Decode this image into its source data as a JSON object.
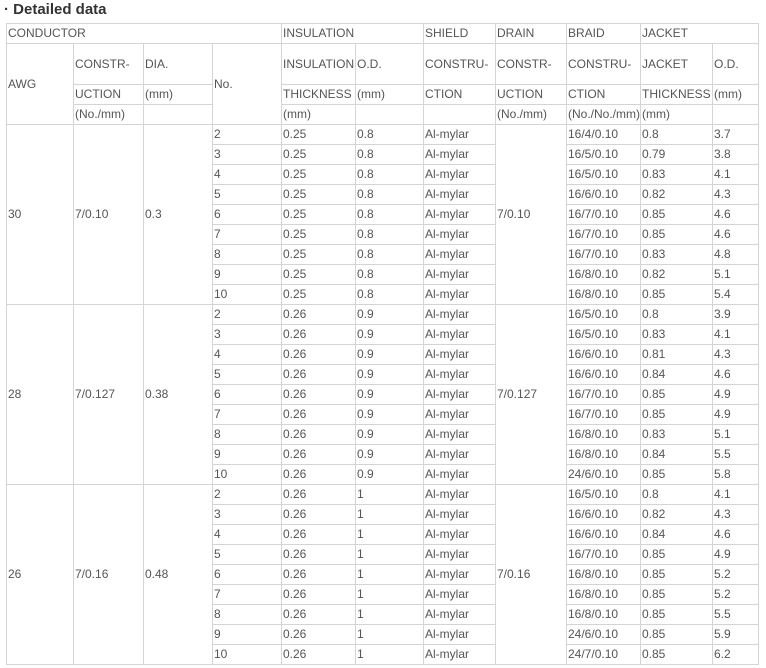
{
  "title": "· Detailed data",
  "header": {
    "conductor": "CONDUCTOR",
    "insulation": "INSULATION",
    "shield": "SHIELD",
    "drain": "DRAIN",
    "braid": "BRAID",
    "jacket": "JACKET",
    "awg": "AWG",
    "no": "No.",
    "constr": [
      "CONSTR-",
      "UCTION",
      "(No./mm)"
    ],
    "dia": [
      "DIA.",
      "(mm)"
    ],
    "ins_thick": [
      "INSULATION",
      "THICKNESS",
      "(mm)"
    ],
    "ins_od": [
      "O.D.",
      "(mm)"
    ],
    "shield_c": [
      "CONSTRU-",
      "CTION"
    ],
    "drain_c": [
      "CONSTR-",
      "UCTION",
      "(No./mm)"
    ],
    "braid_c": [
      "CONSTRU-",
      "CTION",
      "(No./No./mm)"
    ],
    "jacket_thick": [
      "JACKET",
      "THICKNESS",
      "(mm)"
    ],
    "jacket_od": [
      "O.D.",
      "(mm)"
    ]
  },
  "groups": [
    {
      "awg": "30",
      "construction": "7/0.10",
      "dia": "0.3",
      "drain": "7/0.10",
      "rows": [
        [
          "2",
          "0.25",
          "0.8",
          "Al-mylar",
          "16/4/0.10",
          "0.8",
          "3.7"
        ],
        [
          "3",
          "0.25",
          "0.8",
          "Al-mylar",
          "16/5/0.10",
          "0.79",
          "3.8"
        ],
        [
          "4",
          "0.25",
          "0.8",
          "Al-mylar",
          "16/5/0.10",
          "0.83",
          "4.1"
        ],
        [
          "5",
          "0.25",
          "0.8",
          "Al-mylar",
          "16/6/0.10",
          "0.82",
          "4.3"
        ],
        [
          "6",
          "0.25",
          "0.8",
          "Al-mylar",
          "16/7/0.10",
          "0.85",
          "4.6"
        ],
        [
          "7",
          "0.25",
          "0.8",
          "Al-mylar",
          "16/7/0.10",
          "0.85",
          "4.6"
        ],
        [
          "8",
          "0.25",
          "0.8",
          "Al-mylar",
          "16/7/0.10",
          "0.83",
          "4.8"
        ],
        [
          "9",
          "0.25",
          "0.8",
          "Al-mylar",
          "16/8/0.10",
          "0.82",
          "5.1"
        ],
        [
          "10",
          "0.25",
          "0.8",
          "Al-mylar",
          "16/8/0.10",
          "0.85",
          "5.4"
        ]
      ]
    },
    {
      "awg": "28",
      "construction": "7/0.127",
      "dia": "0.38",
      "drain": "7/0.127",
      "rows": [
        [
          "2",
          "0.26",
          "0.9",
          "Al-mylar",
          "16/5/0.10",
          "0.8",
          "3.9"
        ],
        [
          "3",
          "0.26",
          "0.9",
          "Al-mylar",
          "16/5/0.10",
          "0.83",
          "4.1"
        ],
        [
          "4",
          "0.26",
          "0.9",
          "Al-mylar",
          "16/6/0.10",
          "0.81",
          "4.3"
        ],
        [
          "5",
          "0.26",
          "0.9",
          "Al-mylar",
          "16/6/0.10",
          "0.84",
          "4.6"
        ],
        [
          "6",
          "0.26",
          "0.9",
          "Al-mylar",
          "16/7/0.10",
          "0.85",
          "4.9"
        ],
        [
          "7",
          "0.26",
          "0.9",
          "Al-mylar",
          "16/7/0.10",
          "0.85",
          "4.9"
        ],
        [
          "8",
          "0.26",
          "0.9",
          "Al-mylar",
          "16/8/0.10",
          "0.83",
          "5.1"
        ],
        [
          "9",
          "0.26",
          "0.9",
          "Al-mylar",
          "16/8/0.10",
          "0.84",
          "5.5"
        ],
        [
          "10",
          "0.26",
          "0.9",
          "Al-mylar",
          "24/6/0.10",
          "0.85",
          "5.8"
        ]
      ]
    },
    {
      "awg": "26",
      "construction": "7/0.16",
      "dia": "0.48",
      "drain": "7/0.16",
      "rows": [
        [
          "2",
          "0.26",
          "1",
          "Al-mylar",
          "16/5/0.10",
          "0.8",
          "4.1"
        ],
        [
          "3",
          "0.26",
          "1",
          "Al-mylar",
          "16/6/0.10",
          "0.82",
          "4.3"
        ],
        [
          "4",
          "0.26",
          "1",
          "Al-mylar",
          "16/6/0.10",
          "0.84",
          "4.6"
        ],
        [
          "5",
          "0.26",
          "1",
          "Al-mylar",
          "16/7/0.10",
          "0.85",
          "4.9"
        ],
        [
          "6",
          "0.26",
          "1",
          "Al-mylar",
          "16/8/0.10",
          "0.85",
          "5.2"
        ],
        [
          "7",
          "0.26",
          "1",
          "Al-mylar",
          "16/8/0.10",
          "0.85",
          "5.2"
        ],
        [
          "8",
          "0.26",
          "1",
          "Al-mylar",
          "16/8/0.10",
          "0.85",
          "5.5"
        ],
        [
          "9",
          "0.26",
          "1",
          "Al-mylar",
          "24/6/0.10",
          "0.85",
          "5.9"
        ],
        [
          "10",
          "0.26",
          "1",
          "Al-mylar",
          "24/7/0.10",
          "0.85",
          "6.2"
        ]
      ]
    }
  ]
}
